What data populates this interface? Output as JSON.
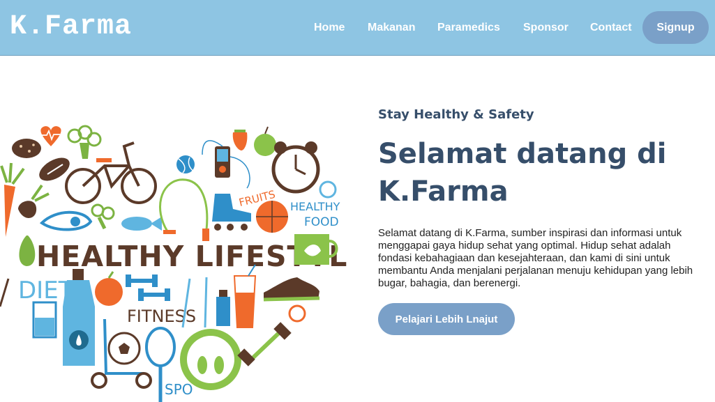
{
  "brand": {
    "name": "K.Farma"
  },
  "nav": {
    "links": [
      "Home",
      "Makanan",
      "Paramedics",
      "Sponsor",
      "Contact"
    ],
    "signup_label": "Signup"
  },
  "hero": {
    "tagline": "Stay Healthy & Safety",
    "headline": "Selamat datang di K.Farma",
    "description": "Selamat datang di K.Farma, sumber inspirasi dan informasi untuk menggapai gaya hidup sehat yang optimal. Hidup sehat adalah fondasi kebahagiaan dan kesejahteraan, dan kami di sini untuk membantu Anda menjalani perjalanan menuju kehidupan yang lebih bugar, bahagia, dan berenergi.",
    "cta_label": "Pelajari Lebih Lnajut",
    "illustration_words": {
      "main": "HEALTHY LIFESTYLE",
      "diet": "DIET",
      "fitness": "FITNESS",
      "fruits": "FRUITS",
      "healthy": "HEALTHY",
      "food": "FOOD",
      "sport": "SPO"
    }
  },
  "colors": {
    "navbar": "#8ec5e3",
    "button": "#7aa0c8",
    "heading": "#364e6a",
    "orange": "#ef6a2c",
    "brown": "#5b3a29",
    "green": "#7cb342",
    "blue": "#2f8fc9"
  },
  "icons": [
    "heart-icon",
    "bicycle-icon",
    "alarm-clock-icon",
    "water-bottle-icon",
    "dumbbell-icon",
    "scale-icon",
    "soccer-ball-icon",
    "sneaker-icon",
    "carrot-icon",
    "mp3-player-icon",
    "roller-skate-icon",
    "basketball-icon",
    "tennis-racket-icon"
  ]
}
